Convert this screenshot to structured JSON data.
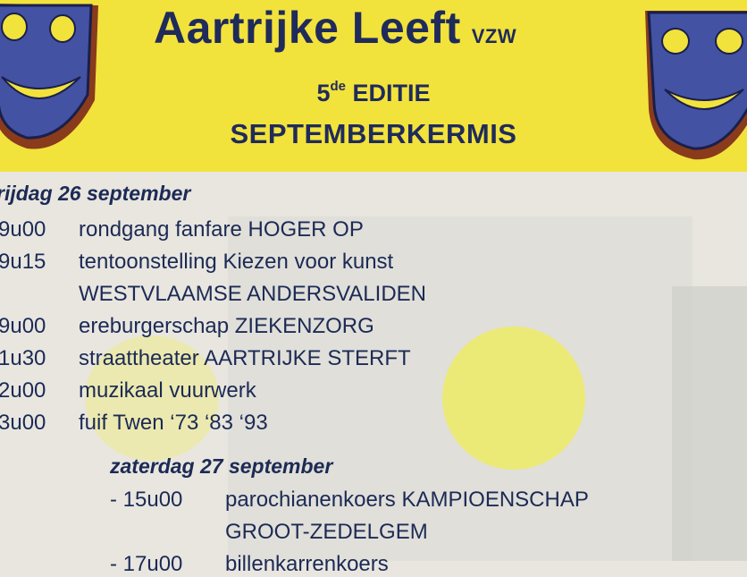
{
  "header": {
    "title": "Aartrijke Leeft",
    "vzw": "VZW",
    "edition_num": "5",
    "edition_sup": "de",
    "edition_word": "EDITIE",
    "subtitle": "SEPTEMBERKERMIS"
  },
  "colors": {
    "header_bg": "#f2e23c",
    "text": "#1c2a55",
    "mask_face": "#4352a3",
    "mask_eyes": "#f2e23c",
    "mask_rim": "#8a3b1c"
  },
  "icons": [
    "theatre-mask-icon",
    "theatre-mask-icon"
  ],
  "friday": {
    "day_label": "rijdag 26 september",
    "items": [
      {
        "time": "9u00",
        "event": "rondgang fanfare HOGER OP"
      },
      {
        "time": "9u15",
        "event": "tentoonstelling Kiezen voor kunst"
      },
      {
        "time": "",
        "event": "WESTVLAAMSE ANDERSVALIDEN"
      },
      {
        "time": "9u00",
        "event": "ereburgerschap ZIEKENZORG"
      },
      {
        "time": "1u30",
        "event": "straattheater AARTRIJKE STERFT"
      },
      {
        "time": "2u00",
        "event": "muzikaal vuurwerk"
      },
      {
        "time": "3u00",
        "event": "fuif Twen ‘73 ‘83 ‘93"
      }
    ]
  },
  "saturday": {
    "day_label": "zaterdag 27 september",
    "items": [
      {
        "time": "- 15u00",
        "event": "parochianenkoers KAMPIOENSCHAP"
      },
      {
        "time": "",
        "event": "GROOT-ZEDELGEM"
      },
      {
        "time": "- 17u00",
        "event": "billenkarrenkoers"
      }
    ]
  }
}
